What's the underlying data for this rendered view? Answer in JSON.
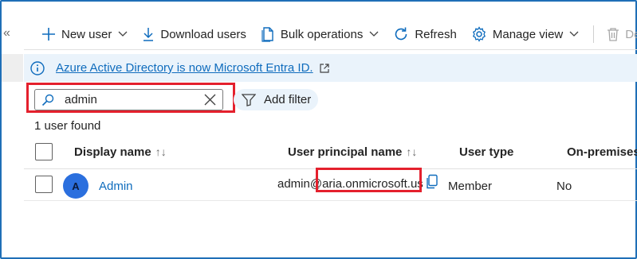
{
  "sidebar": {
    "collapse_glyph": "«"
  },
  "toolbar": {
    "new_user": "New user",
    "download_users": "Download users",
    "bulk_operations": "Bulk operations",
    "refresh": "Refresh",
    "manage_view": "Manage view",
    "delete_partial": "De"
  },
  "banner": {
    "text": "Azure Active Directory is now Microsoft Entra ID."
  },
  "search": {
    "value": "admin"
  },
  "filter": {
    "label": "Add filter"
  },
  "results": {
    "count_text": "1 user found"
  },
  "table": {
    "columns": {
      "display_name": "Display name",
      "upn": "User principal name",
      "user_type": "User type",
      "on_premises": "On-premises"
    },
    "sort_glyph": "↑↓",
    "rows": [
      {
        "initial": "A",
        "display_name": "Admin",
        "upn_prefix": "admin@",
        "upn_domain": "aria.onmicrosoft.us",
        "user_type": "Member",
        "on_premises": "No"
      }
    ]
  },
  "colors": {
    "accent": "#0f6cbd",
    "highlight": "#e4202d",
    "banner_bg": "#eaf3fb",
    "avatar": "#2b6fde"
  }
}
